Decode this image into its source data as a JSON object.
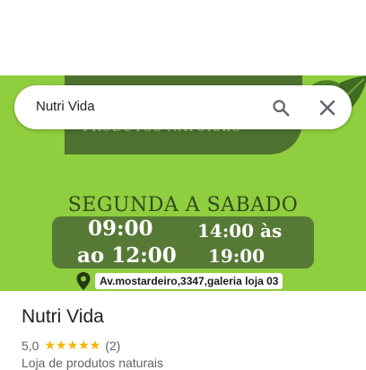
{
  "search": {
    "query": "Nutri Vida"
  },
  "hero": {
    "logo_subtext": "PRODUTOS NATURAIS",
    "days": "SEGUNDA A SABADO",
    "hours": {
      "morning_open": "09:00",
      "morning_close": "ao 12:00",
      "afternoon_open": "14:00 às",
      "afternoon_close": "19:00"
    },
    "address": "Av.mostardeiro,3347,galeria loja 03"
  },
  "place": {
    "title": "Nutri Vida",
    "rating": "5,0",
    "stars": "★★★★★",
    "review_count": "(2)",
    "category": "Loja de produtos naturais"
  },
  "colors": {
    "hero_green": "#8fce3e",
    "hours_box": "#567a35",
    "star": "#f4b400"
  },
  "icons": {
    "search": "search-icon",
    "clear": "close-icon",
    "pin": "map-pin-icon"
  }
}
